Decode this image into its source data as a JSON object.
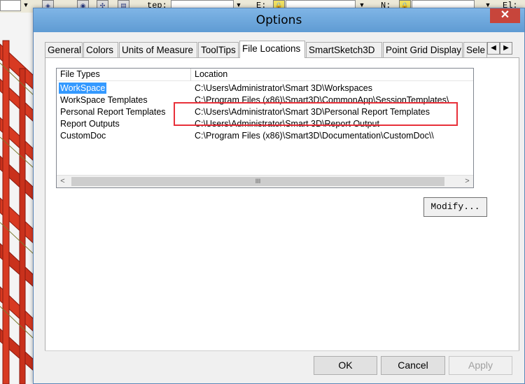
{
  "toolbar": {
    "step_label": "tep:",
    "e_label": "E:",
    "n_label": "N:",
    "el_label": "El:",
    "icons": [
      "select-icon",
      "zoom-icon",
      "rotate-icon",
      "pan-icon",
      "layer-icon",
      "lock-icon",
      "lock-icon"
    ]
  },
  "dialog": {
    "title": "Options",
    "close_glyph": "✕",
    "tabs": [
      {
        "label": "General"
      },
      {
        "label": "Colors"
      },
      {
        "label": "Units of Measure"
      },
      {
        "label": "ToolTips"
      },
      {
        "label": "File Locations",
        "active": true
      },
      {
        "label": "SmartSketch3D"
      },
      {
        "label": "Point Grid Display"
      },
      {
        "label": "Sele"
      }
    ],
    "tab_scroll_left": "◀",
    "tab_scroll_right": "▶",
    "list": {
      "headers": {
        "type": "File Types",
        "location": "Location"
      },
      "rows": [
        {
          "type": "WorkSpace",
          "location": "C:\\Users\\Administrator\\Smart 3D\\Workspaces",
          "selected": true
        },
        {
          "type": "WorkSpace Templates",
          "location": "C:\\Program Files (x86)\\Smart3D\\CommonApp\\SessionTemplates\\"
        },
        {
          "type": "Personal Report Templates",
          "location": "C:\\Users\\Administrator\\Smart 3D\\Personal Report Templates"
        },
        {
          "type": "Report Outputs",
          "location": "C:\\Users\\Administrator\\Smart 3D\\Report Output"
        },
        {
          "type": "CustomDoc",
          "location": "C:\\Program Files (x86)\\Smart3D\\Documentation\\CustomDoc\\\\"
        }
      ],
      "scroll_left": "<",
      "scroll_right": ">",
      "scroll_grip": "III"
    },
    "modify_label": "Modify...",
    "ok_label": "OK",
    "cancel_label": "Cancel",
    "apply_label": "Apply",
    "colors": {
      "highlight": "#e8303a",
      "selection": "#3399ff",
      "titlebar": "#6fa8dc",
      "close": "#c7453b"
    }
  }
}
